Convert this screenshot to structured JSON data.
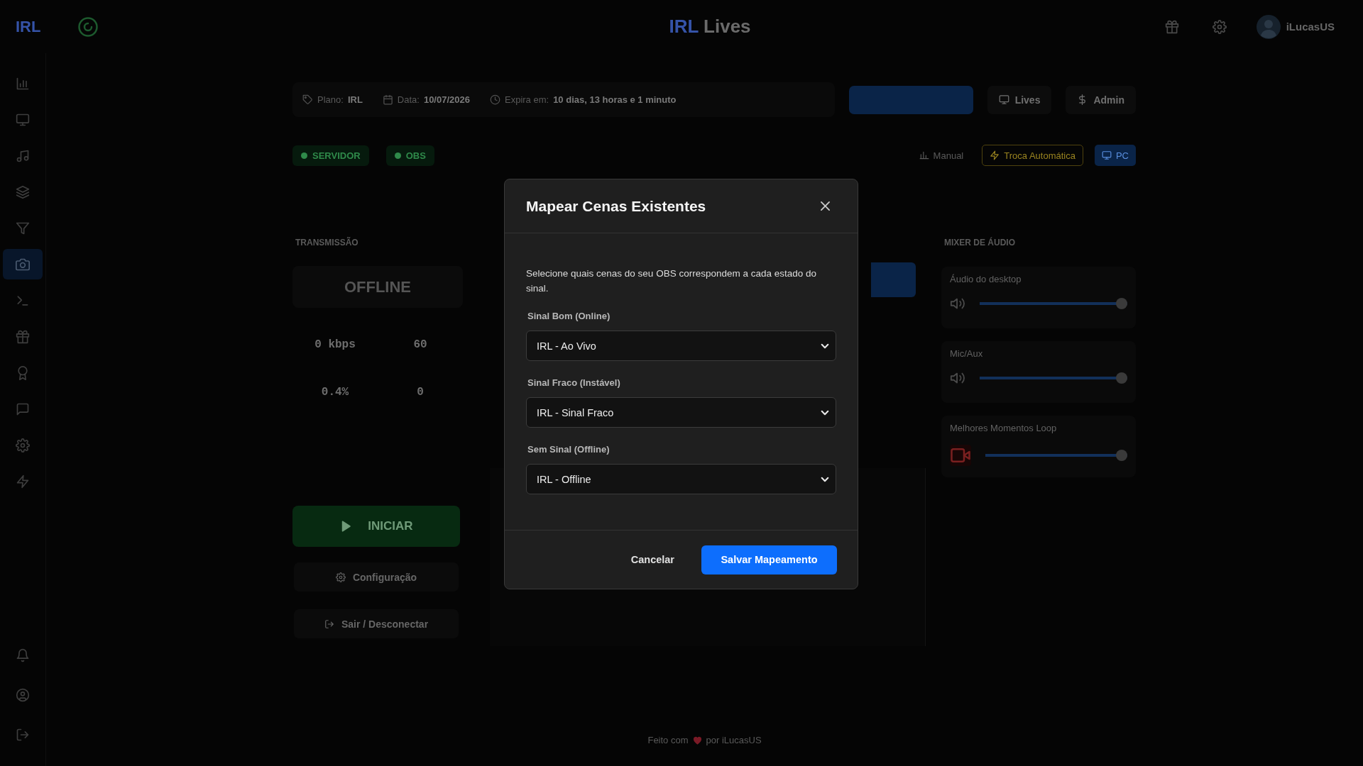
{
  "header": {
    "logo": "IRL",
    "brand": "IRL",
    "title": "Lives",
    "username": "iLucasUS"
  },
  "sidebar": {
    "items": [
      {
        "selected": false
      },
      {
        "selected": false
      },
      {
        "selected": false
      },
      {
        "selected": false
      },
      {
        "selected": false
      },
      {
        "selected": true
      },
      {
        "selected": false
      },
      {
        "selected": false
      },
      {
        "selected": false
      },
      {
        "selected": false
      },
      {
        "selected": false
      },
      {
        "selected": false
      }
    ]
  },
  "info_bar": {
    "items": [
      {
        "label": "Plano:",
        "value": "IRL"
      },
      {
        "label": "Data:",
        "value": "10/07/2026"
      },
      {
        "label": "Expira em:",
        "value": "10 dias, 13 horas e 1 minuto"
      }
    ],
    "buttons": [
      {
        "kind": "primary"
      },
      {
        "label": "Lives",
        "kind": "secondary"
      },
      {
        "label": "Admin",
        "kind": "secondary"
      }
    ]
  },
  "status_row": {
    "badges": [
      {
        "label": "SERVIDOR"
      },
      {
        "label": "OBS"
      }
    ],
    "controls": [
      {
        "label": "Manual",
        "kind": "plain"
      },
      {
        "label": "Troca Automática",
        "kind": "warning"
      },
      {
        "label": "PC",
        "kind": "primary"
      }
    ]
  },
  "stream": {
    "title": "TRANSMISSÃO",
    "status": "OFFLINE",
    "stats": [
      {
        "value": "0 kbps"
      },
      {
        "value": "60"
      },
      {
        "value": "0.4%"
      },
      {
        "value": "0"
      }
    ],
    "start_button": "INICIAR",
    "config_button": "Configuração",
    "exit_button": "Sair / Desconectar"
  },
  "mixer": {
    "title": "MIXER DE ÁUDIO",
    "channels": [
      {
        "name": "Áudio do desktop",
        "kind": "speaker",
        "level": 1
      },
      {
        "name": "Mic/Aux",
        "kind": "speaker",
        "level": 1
      },
      {
        "name": "Melhores Momentos Loop",
        "kind": "media",
        "level": 1
      }
    ]
  },
  "footer": {
    "prefix": "Feito com",
    "suffix": "por iLucasUS"
  },
  "modal": {
    "title": "Mapear Cenas Existentes",
    "description": "Selecione quais cenas do seu OBS correspondem a cada estado do sinal.",
    "fields": [
      {
        "label": "Sinal Bom (Online)",
        "value": "IRL - Ao Vivo"
      },
      {
        "label": "Sinal Fraco (Instável)",
        "value": "IRL - Sinal Fraco"
      },
      {
        "label": "Sem Sinal (Offline)",
        "value": "IRL - Offline"
      }
    ],
    "buttons": [
      {
        "label": "Cancelar",
        "kind": "secondary"
      },
      {
        "label": "Salvar Mapeamento",
        "kind": "primary"
      }
    ]
  }
}
